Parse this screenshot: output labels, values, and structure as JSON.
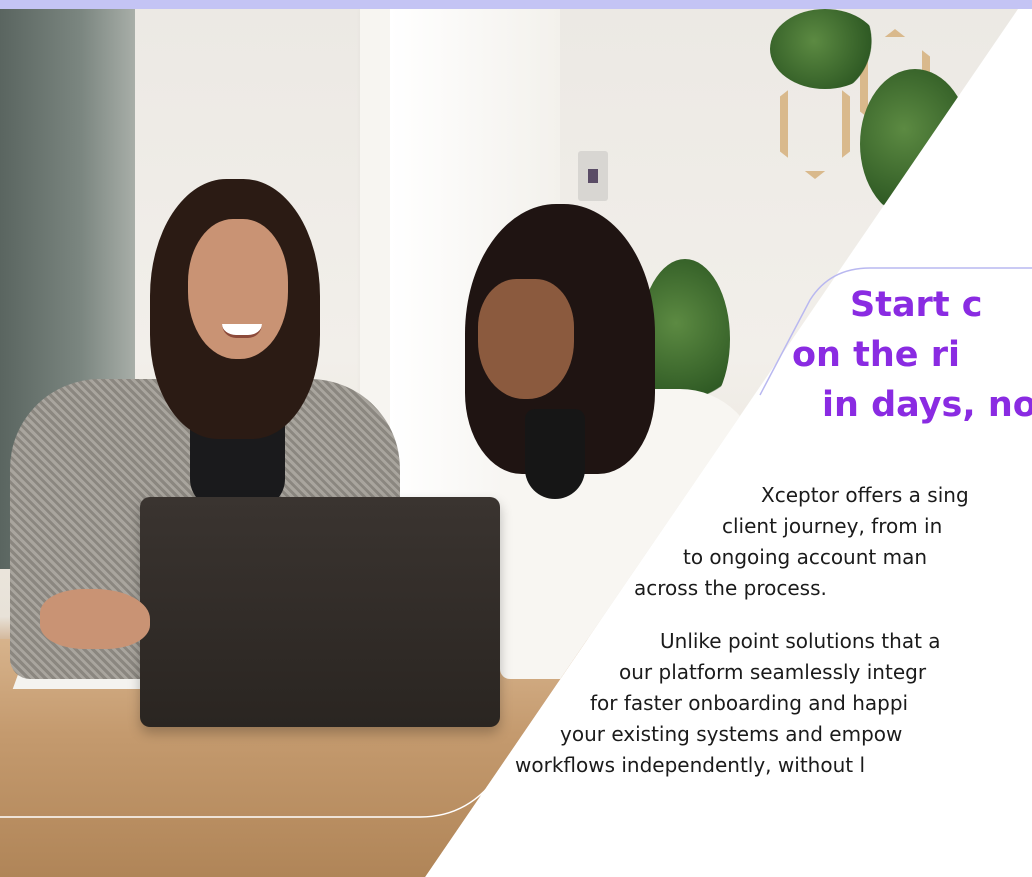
{
  "headline": {
    "line1": "Start c",
    "line2": "on the ri",
    "line3": "in days, no"
  },
  "paragraph1": {
    "line1": "Xceptor offers a sing",
    "line2": "client journey, from in",
    "line3": "to ongoing account man",
    "line4": "across the process."
  },
  "paragraph2": {
    "line1": "Unlike point solutions that a",
    "line2": "our platform seamlessly integr",
    "line3": "for faster onboarding and happi",
    "line4": "your existing systems and empow",
    "line5": "workflows independently, without l"
  },
  "colors": {
    "accent": "#8a2be2",
    "top_bar": "#c4c4f4",
    "outline": "#b9b8f0"
  }
}
